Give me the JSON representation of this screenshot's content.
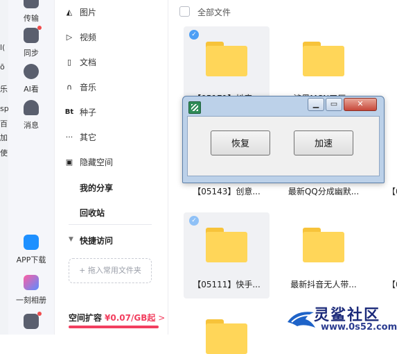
{
  "left_strip": {
    "fragments": [
      "l(",
      "ō",
      "乐",
      "sp",
      "百",
      "加",
      "使"
    ]
  },
  "app_nav": {
    "items": [
      {
        "label": "传输",
        "icon": "transfer-icon"
      },
      {
        "label": "同步",
        "icon": "sync-icon"
      },
      {
        "label": "AI看",
        "icon": "ai-icon"
      },
      {
        "label": "消息",
        "icon": "message-icon"
      },
      {
        "label": "APP下载",
        "icon": "phone-icon"
      },
      {
        "label": "一刻相册",
        "icon": "album-icon"
      }
    ]
  },
  "categories": [
    {
      "label": "图片",
      "icon": "image-icon",
      "glyph": "◭"
    },
    {
      "label": "视频",
      "icon": "video-icon",
      "glyph": "▷"
    },
    {
      "label": "文档",
      "icon": "document-icon",
      "glyph": "▯"
    },
    {
      "label": "音乐",
      "icon": "headphone-icon",
      "glyph": "∩"
    },
    {
      "label": "种子",
      "icon": "torrent-icon",
      "glyph": "Bt"
    },
    {
      "label": "其它",
      "icon": "more-icon",
      "glyph": "···"
    },
    {
      "label": "隐藏空间",
      "icon": "lock-icon",
      "glyph": "▣"
    }
  ],
  "my_share": "我的分享",
  "recycle_bin": "回收站",
  "quick_access": "快捷访问",
  "pin_folder": "+ 拖入常用文件夹",
  "storage": {
    "title": "空间扩容",
    "price": "¥0.07/GB起",
    "arrow": ">"
  },
  "main": {
    "all_files": "全部文件",
    "files": [
      {
        "name": "【05171】抖音...",
        "selected": true
      },
      {
        "name": "涉黑MCN工厂...",
        "selected": false
      },
      {
        "name": "【05143】创意...",
        "selected": false
      },
      {
        "name": "最新QQ分成幽默...",
        "selected": false
      },
      {
        "name": "【05111】快手...",
        "selected": true
      },
      {
        "name": "最新抖音无人带...",
        "selected": false
      }
    ],
    "edge_fragments": [
      "【0",
      "【0"
    ]
  },
  "dialog": {
    "minimize": "▁",
    "maximize": "▭",
    "close": "✕",
    "restore_button": "恢复",
    "speedup_button": "加速"
  },
  "watermark": {
    "brand": "灵鲨社区",
    "url": "www.0s52.com"
  },
  "colors": {
    "accent": "#4d9ff5",
    "price": "#f23f5f",
    "folder": "#ffd659"
  }
}
